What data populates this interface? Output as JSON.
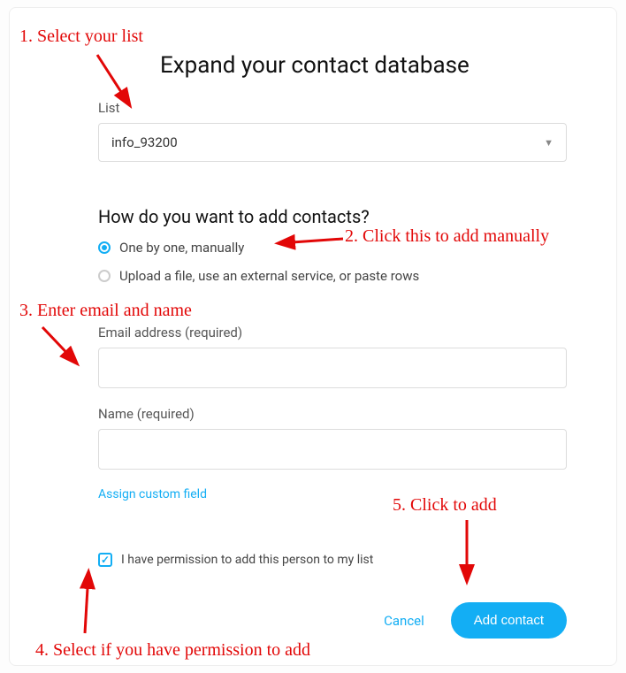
{
  "heading": "Expand your contact database",
  "list": {
    "label": "List",
    "selected": "info_93200"
  },
  "how": {
    "title": "How do you want to add contacts?",
    "option_manual": "One by one, manually",
    "option_upload": "Upload a file, use an external service, or paste rows"
  },
  "form": {
    "email_label": "Email address (required)",
    "name_label": "Name (required)",
    "assign_link": "Assign custom field"
  },
  "permission": {
    "label": "I have permission to add this person to my list"
  },
  "actions": {
    "cancel": "Cancel",
    "add": "Add contact"
  },
  "annotations": {
    "a1": "1. Select your list",
    "a2": "2. Click this to add manually",
    "a3": "3. Enter email and name",
    "a4": "4. Select if you have permission to add",
    "a5": "5. Click to add"
  }
}
